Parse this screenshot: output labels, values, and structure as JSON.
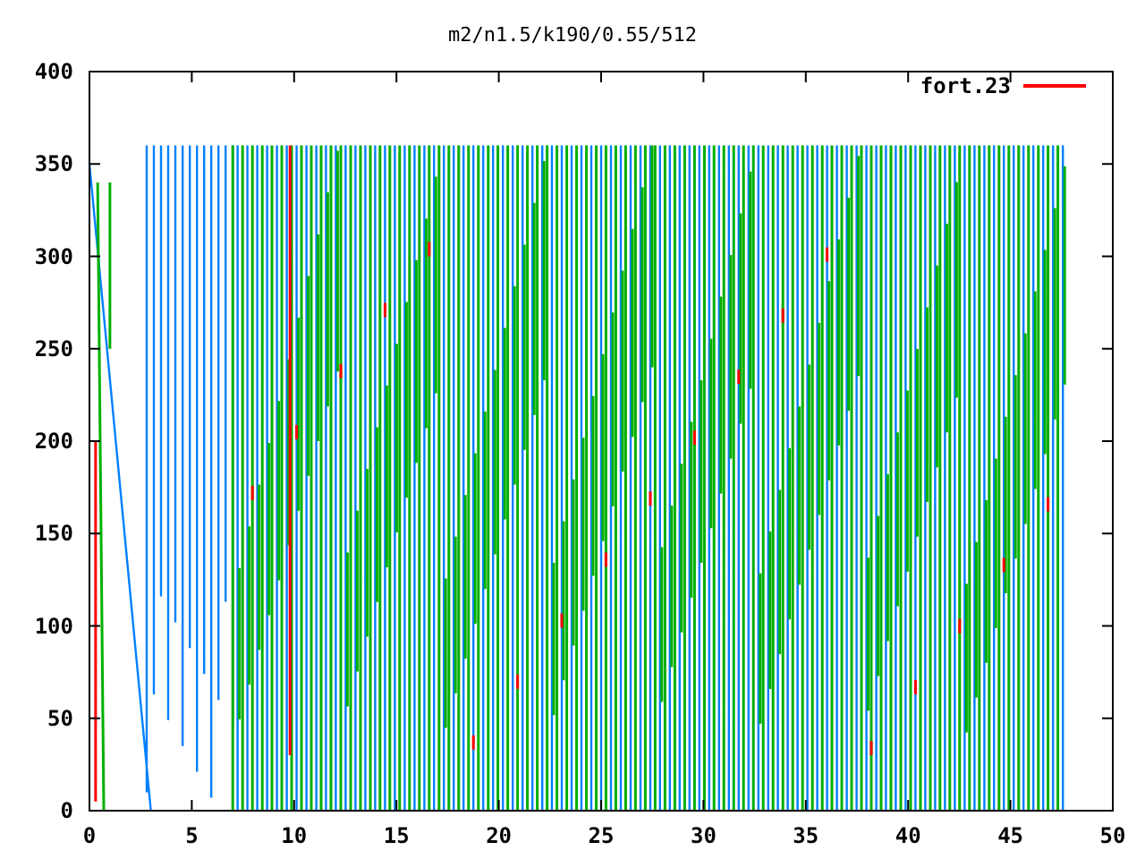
{
  "title": "m2/n1.5/k190/0.55/512",
  "legend": {
    "label": "fort.23",
    "color": "#ff0000"
  },
  "x_tick_labels": [
    "0",
    "5",
    "10",
    "15",
    "20",
    "25",
    "30",
    "35",
    "40",
    "45",
    "50"
  ],
  "y_tick_labels": [
    "400",
    "350",
    "300",
    "250",
    "200",
    "150",
    "100",
    "50",
    "0"
  ]
}
